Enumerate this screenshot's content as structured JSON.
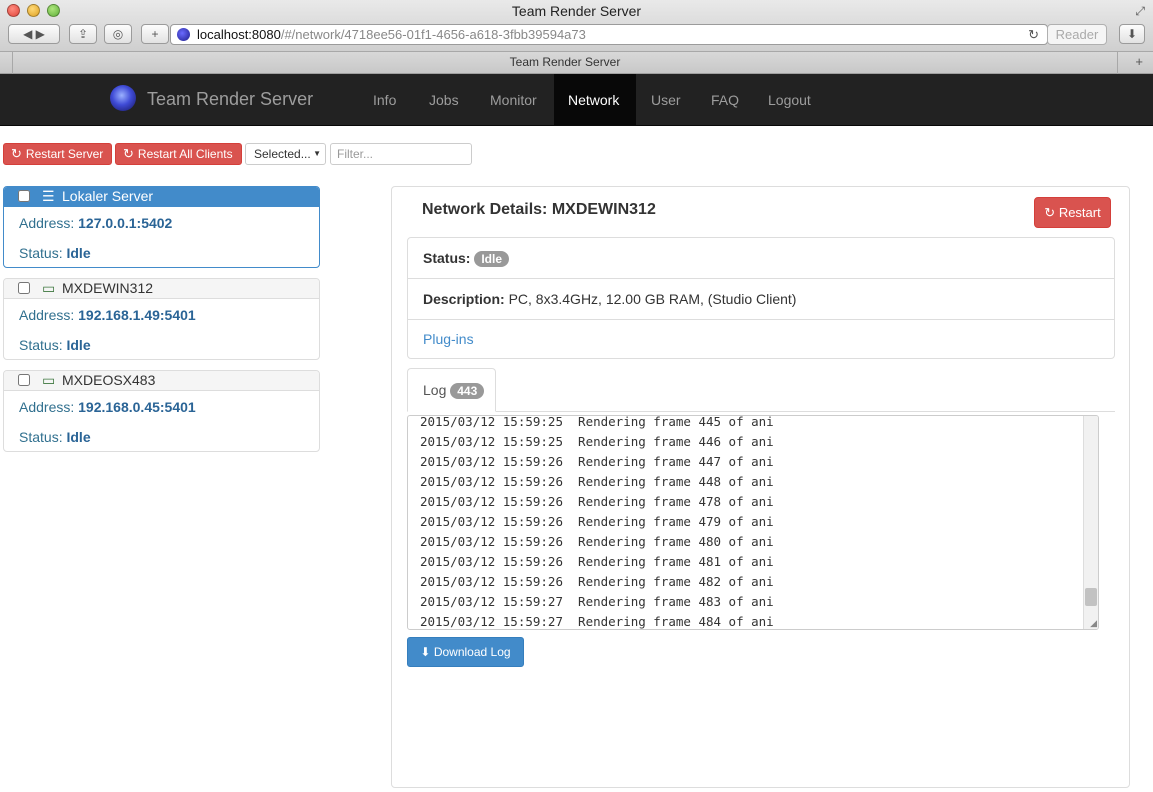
{
  "window": {
    "title": "Team Render Server",
    "tab_title": "Team Render Server"
  },
  "browser": {
    "url_host": "localhost:8080",
    "url_path": "/#/network/4718ee56-01f1-4656-a618-3fbb39594a73",
    "reader_label": "Reader"
  },
  "navbar": {
    "brand": "Team Render Server",
    "items": [
      {
        "label": "Info"
      },
      {
        "label": "Jobs"
      },
      {
        "label": "Monitor"
      },
      {
        "label": "Network",
        "active": true
      },
      {
        "label": "User"
      },
      {
        "label": "FAQ"
      },
      {
        "label": "Logout"
      }
    ]
  },
  "toolbar": {
    "restart_server": "Restart Server",
    "restart_all_clients": "Restart All Clients",
    "selected_option": "Selected...",
    "filter_placeholder": "Filter..."
  },
  "clients": [
    {
      "name": "Lokaler Server",
      "address_label": "Address:",
      "address": "127.0.0.1:5402",
      "status_label": "Status:",
      "status": "Idle",
      "icon": "server-icon",
      "selected": true
    },
    {
      "name": "MXDEWIN312",
      "address_label": "Address:",
      "address": "192.168.1.49:5401",
      "status_label": "Status:",
      "status": "Idle",
      "icon": "monitor-icon",
      "selected": false
    },
    {
      "name": "MXDEOSX483",
      "address_label": "Address:",
      "address": "192.168.0.45:5401",
      "status_label": "Status:",
      "status": "Idle",
      "icon": "monitor-icon",
      "selected": false
    }
  ],
  "details": {
    "title": "Network Details: MXDEWIN312",
    "restart_label": "Restart",
    "status_label": "Status:",
    "status_value": "Idle",
    "description_label": "Description:",
    "description_value": "PC, 8x3.4GHz, 12.00 GB RAM, (Studio Client)",
    "plugins_label": "Plug-ins"
  },
  "log": {
    "tab_label": "Log",
    "count": "443",
    "lines": [
      "2015/03/12 15:59:25  Rendering frame 445 of ani",
      "2015/03/12 15:59:25  Rendering frame 446 of ani",
      "2015/03/12 15:59:26  Rendering frame 447 of ani",
      "2015/03/12 15:59:26  Rendering frame 448 of ani",
      "2015/03/12 15:59:26  Rendering frame 478 of ani",
      "2015/03/12 15:59:26  Rendering frame 479 of ani",
      "2015/03/12 15:59:26  Rendering frame 480 of ani",
      "2015/03/12 15:59:26  Rendering frame 481 of ani",
      "2015/03/12 15:59:26  Rendering frame 482 of ani",
      "2015/03/12 15:59:27  Rendering frame 483 of ani",
      "2015/03/12 15:59:27  Rendering frame 484 of ani"
    ],
    "download_label": "Download Log"
  },
  "colors": {
    "danger": "#d9534f",
    "primary": "#428bca",
    "navbar": "#222222",
    "link": "#428bca"
  }
}
